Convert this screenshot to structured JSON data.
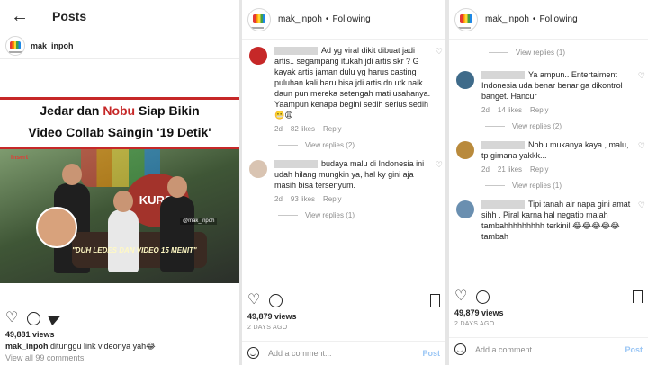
{
  "panel1": {
    "back_icon": "arrow-left-icon",
    "title": "Posts",
    "username": "mak_inpoh",
    "image": {
      "headline_line1_a": "Jedar dan ",
      "headline_line1_b": "Nobu",
      "headline_line1_c": " Siap Bikin",
      "headline_line2": "Video Collab Saingin '19 Detik'",
      "sign": "KURSI",
      "caption": "\"DUH LEDES DAN VIDEO 15 MENIT\"",
      "source": "Insert",
      "watermark": "@mak_inpoh"
    },
    "views": "49,881 views",
    "caption_user": "mak_inpoh",
    "caption_text": " ditunggu link videonya yah😂",
    "view_all": "View all 99 comments"
  },
  "panel2": {
    "username": "mak_inpoh",
    "separator": "•",
    "following": "Following",
    "comments": [
      {
        "text": "Ad yg viral dikit dibuat jadi artis.. segampang itukah jdi artis skr ? G kayak artis jaman dulu yg harus casting puluhan kali baru bisa jdi artis dn utk naik daun pun mereka setengah mati usahanya. Yaampun kenapa begini sedih serius sedih 😬😩",
        "time": "2d",
        "likes": "82 likes",
        "reply": "Reply",
        "view_replies": "View replies (2)",
        "avatar_color": "#c62828"
      },
      {
        "text": "budaya malu di Indonesia ini udah hilang mungkin ya, hal ky gini aja masih bisa tersenyum.",
        "time": "2d",
        "likes": "93 likes",
        "reply": "Reply",
        "view_replies": "View replies (1)",
        "avatar_color": "#d9c4b2"
      }
    ],
    "views": "49,879 views",
    "ago": "2 DAYS AGO",
    "add_comment": "Add a comment...",
    "post": "Post"
  },
  "panel3": {
    "username": "mak_inpoh",
    "separator": "•",
    "following": "Following",
    "top_view_replies": "View replies (1)",
    "comments": [
      {
        "text": "Ya ampun.. Entertaiment Indonesia uda benar benar ga dikontrol banget. Hancur",
        "time": "2d",
        "likes": "14 likes",
        "reply": "Reply",
        "view_replies": "View replies (2)",
        "avatar_color": "#3f6b8a"
      },
      {
        "text": "Nobu mukanya kaya , malu, tp gimana yakkk...",
        "time": "2d",
        "likes": "21 likes",
        "reply": "Reply",
        "view_replies": "View replies (1)",
        "avatar_color": "#b98a3c"
      },
      {
        "text": "Tipi tanah air napa gini amat sihh . Piral karna hal negatip malah tambahhhhhhhhh terkinil 😂😂😂😂😂 tambah",
        "time": "",
        "likes": "",
        "reply": "",
        "view_replies": "",
        "avatar_color": "#6a8fb0"
      }
    ],
    "views": "49,879 views",
    "ago": "2 DAYS AGO",
    "add_comment": "Add a comment...",
    "post": "Post"
  }
}
